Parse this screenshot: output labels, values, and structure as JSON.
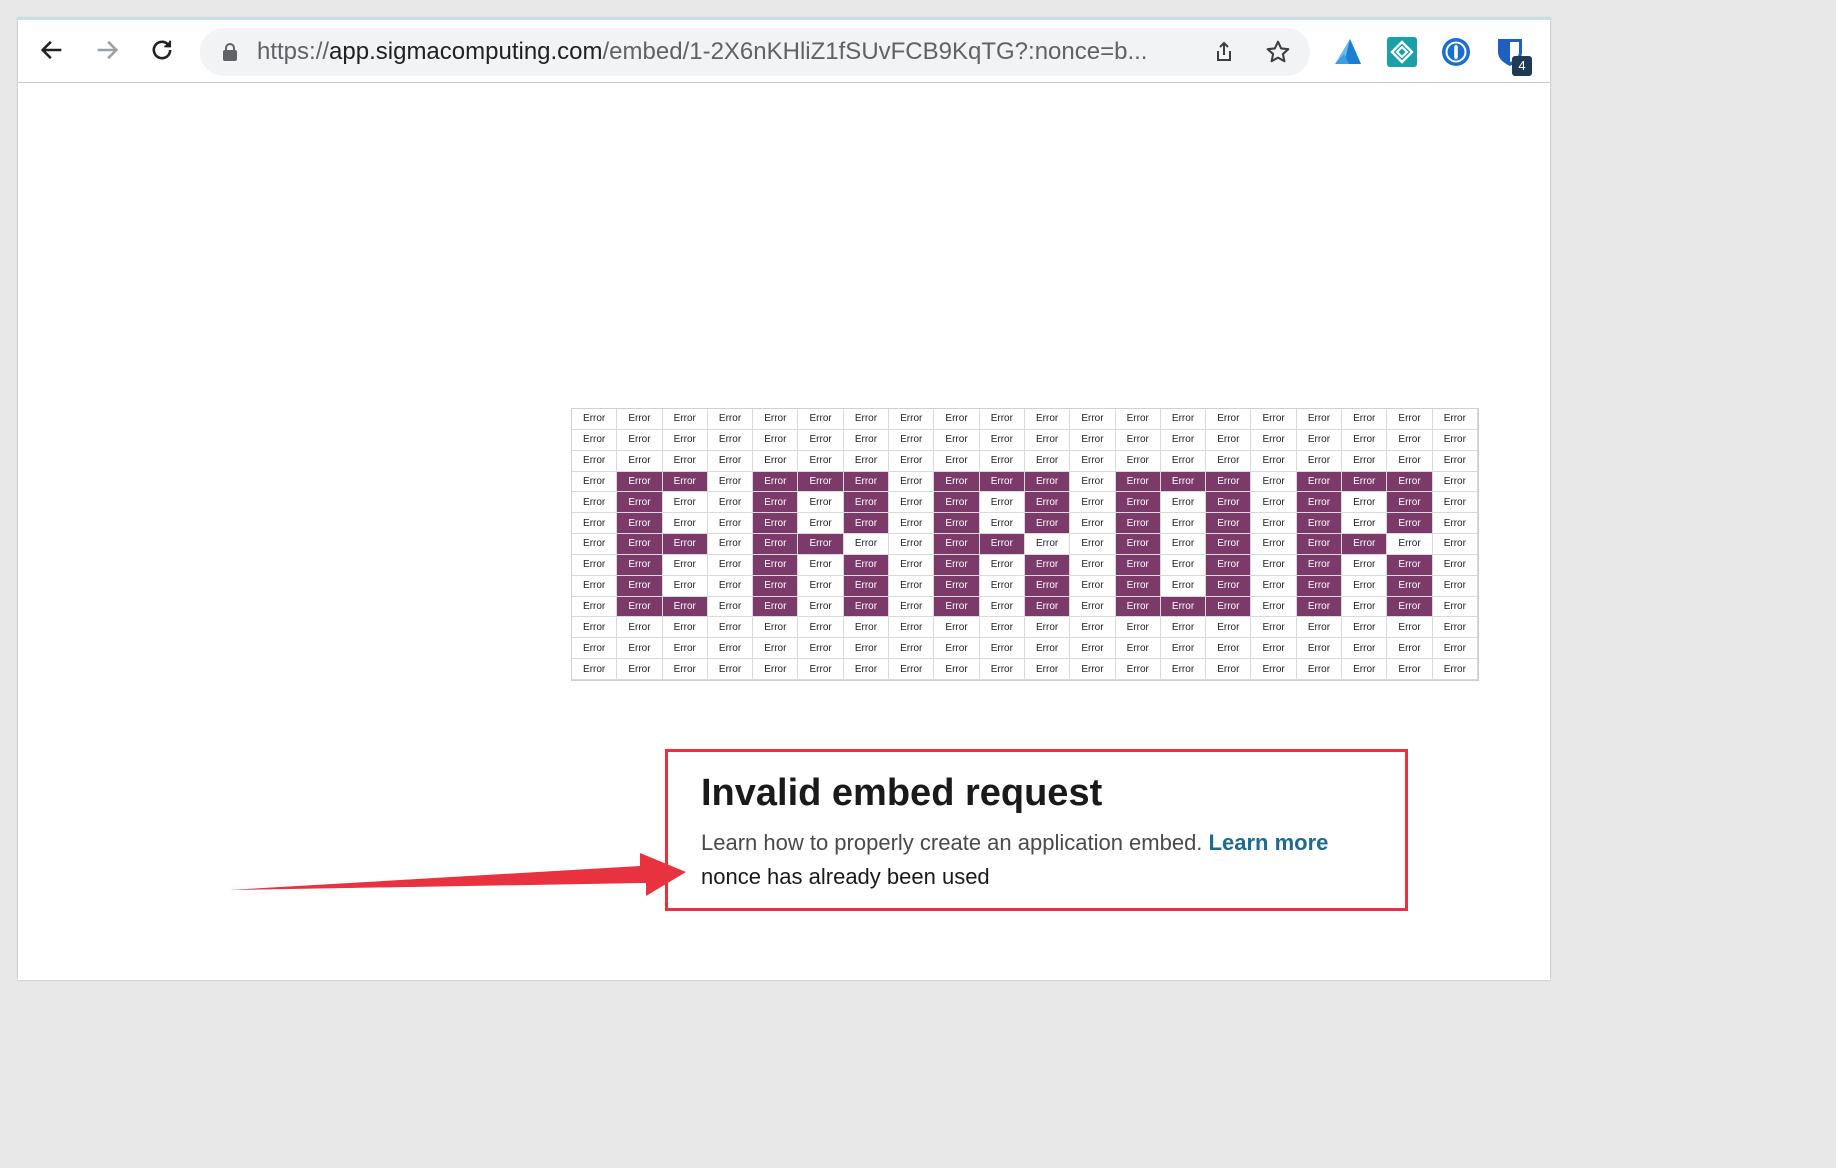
{
  "browser": {
    "url_scheme": "https://",
    "url_host": "app.sigmacomputing.com",
    "url_path": "/embed/1-2X6nKHliZ1fSUvFCB9KqTG?:nonce=b...",
    "extension_badge": "4"
  },
  "grid": {
    "cell_text": "Error",
    "rows": 13,
    "cols": 20,
    "highlight_color": "#7b3a69",
    "highlighted_cells": [
      "3-1",
      "3-2",
      "3-4",
      "3-5",
      "3-6",
      "3-8",
      "3-9",
      "3-10",
      "3-12",
      "3-13",
      "3-14",
      "3-16",
      "3-17",
      "3-18",
      "4-1",
      "4-4",
      "4-6",
      "4-8",
      "4-10",
      "4-12",
      "4-14",
      "4-16",
      "4-18",
      "5-1",
      "5-4",
      "5-6",
      "5-8",
      "5-10",
      "5-12",
      "5-14",
      "5-16",
      "5-18",
      "6-1",
      "6-2",
      "6-4",
      "6-5",
      "6-8",
      "6-9",
      "6-12",
      "6-14",
      "6-16",
      "6-17",
      "7-1",
      "7-4",
      "7-6",
      "7-8",
      "7-10",
      "7-12",
      "7-14",
      "7-16",
      "7-18",
      "8-1",
      "8-4",
      "8-6",
      "8-8",
      "8-10",
      "8-12",
      "8-14",
      "8-16",
      "8-18",
      "9-1",
      "9-2",
      "9-4",
      "9-6",
      "9-8",
      "9-10",
      "9-12",
      "9-13",
      "9-14",
      "9-16",
      "9-18"
    ]
  },
  "error": {
    "title": "Invalid embed request",
    "description": "Learn how to properly create an application embed. ",
    "link_label": "Learn more",
    "reason": "nonce has already been used"
  },
  "colors": {
    "annotation": "#e8323f",
    "link": "#1d6a93"
  }
}
